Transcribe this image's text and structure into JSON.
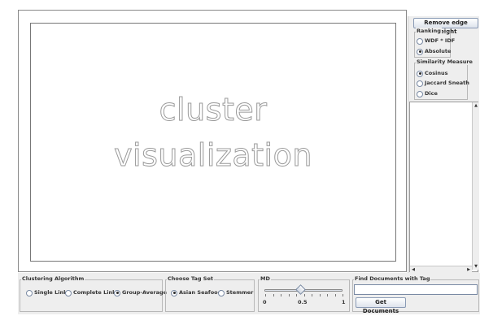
{
  "canvas": {
    "title_line1": "cluster",
    "title_line2": "visualization"
  },
  "right_panel": {
    "remove_button": "Remove edge weight",
    "ranking": {
      "title": "Ranking",
      "options": [
        {
          "label": "WDF * IDF",
          "selected": false
        },
        {
          "label": "Absolute",
          "selected": true
        }
      ]
    },
    "similarity": {
      "title": "Similarity Measure",
      "options": [
        {
          "label": "Cosinus",
          "selected": true
        },
        {
          "label": "Jaccard Sneath",
          "selected": false
        },
        {
          "label": "Dice",
          "selected": false
        }
      ]
    }
  },
  "bottom": {
    "clustering": {
      "title": "Clustering Algorithm",
      "options": [
        {
          "label": "Single Link",
          "selected": false
        },
        {
          "label": "Complete Link",
          "selected": false
        },
        {
          "label": "Group-Average",
          "selected": true
        }
      ]
    },
    "tagset": {
      "title": "Choose Tag Set",
      "options": [
        {
          "label": "Asian Seafood",
          "selected": true
        },
        {
          "label": "Stemmer",
          "selected": false
        }
      ]
    },
    "md": {
      "title": "MD",
      "value": 0.45,
      "ticks": [
        "0",
        "0.5",
        "1"
      ]
    },
    "find": {
      "title": "Find Documents with Tag",
      "input_value": "",
      "button": "Get Documents"
    }
  }
}
